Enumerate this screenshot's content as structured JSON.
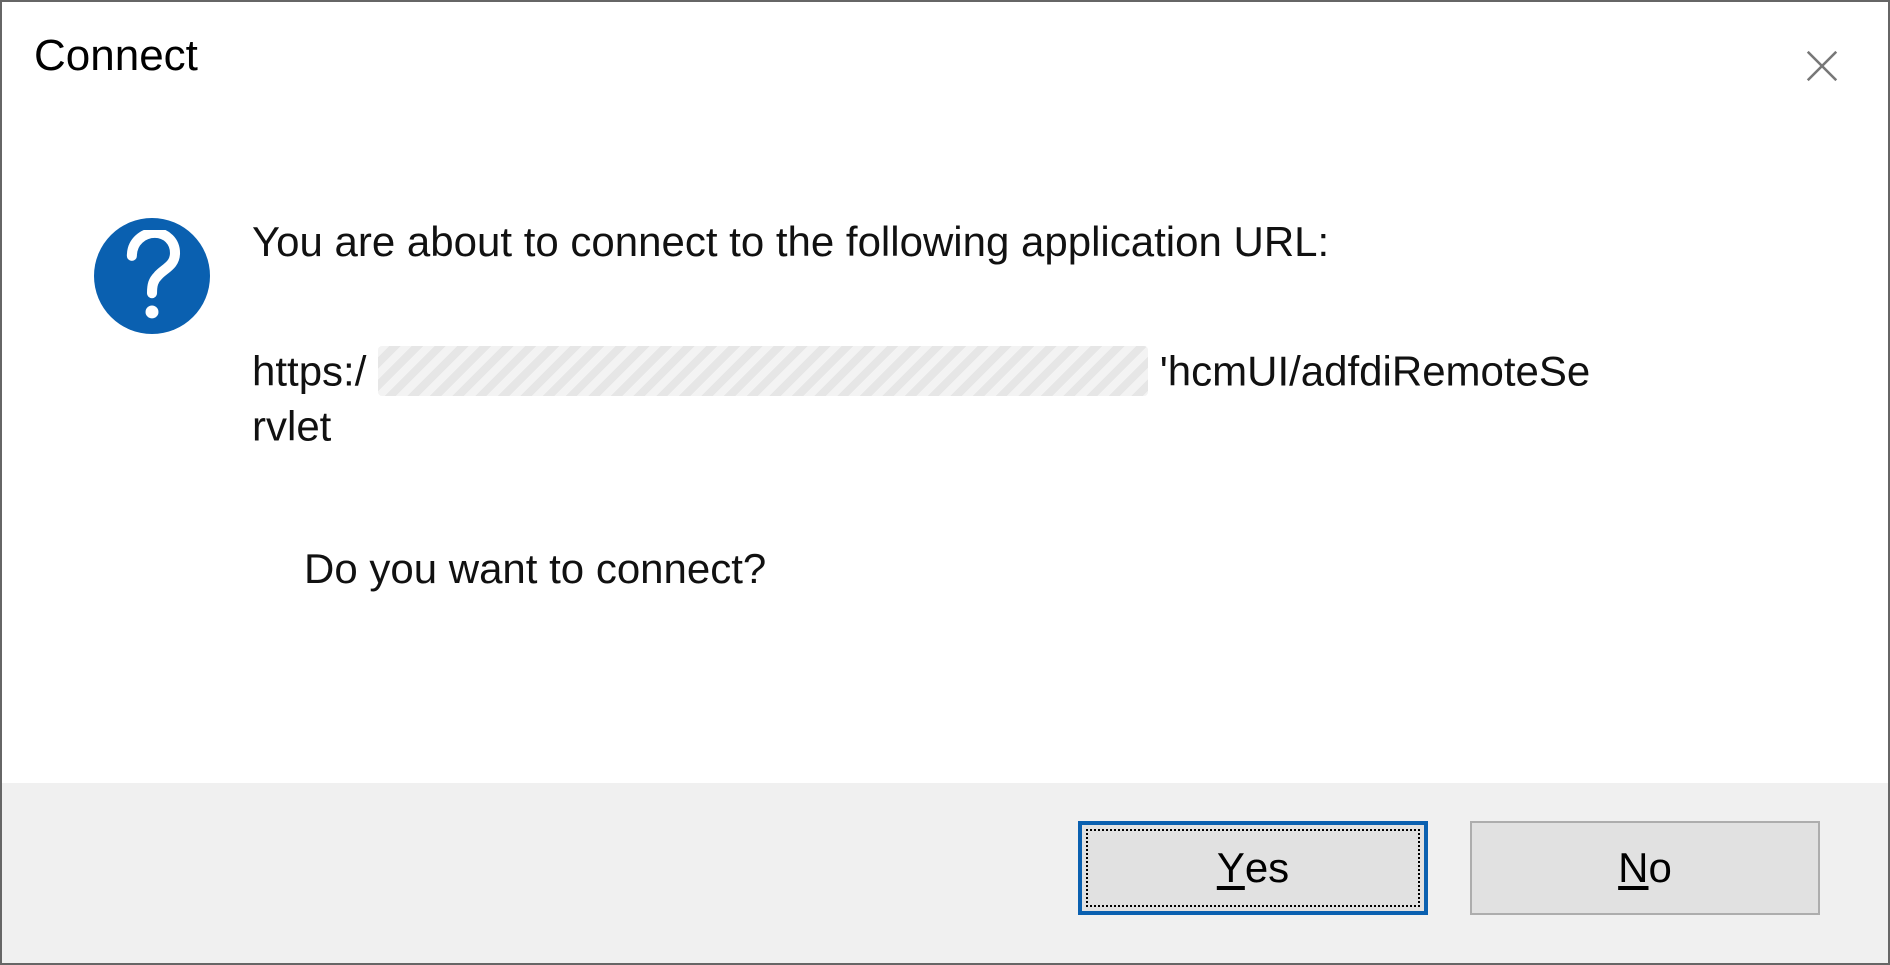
{
  "dialog": {
    "title": "Connect",
    "message_line1": "You are about to connect to the following application URL:",
    "url_parts": {
      "prefix": "https:/",
      "suffix_top": "'hcmUI/adfdiRemoteSe",
      "suffix_bottom": "rvlet"
    },
    "ask": "Do you want to connect?",
    "buttons": {
      "yes_accel": "Y",
      "yes_rest": "es",
      "no_accel": "N",
      "no_rest": "o"
    }
  }
}
